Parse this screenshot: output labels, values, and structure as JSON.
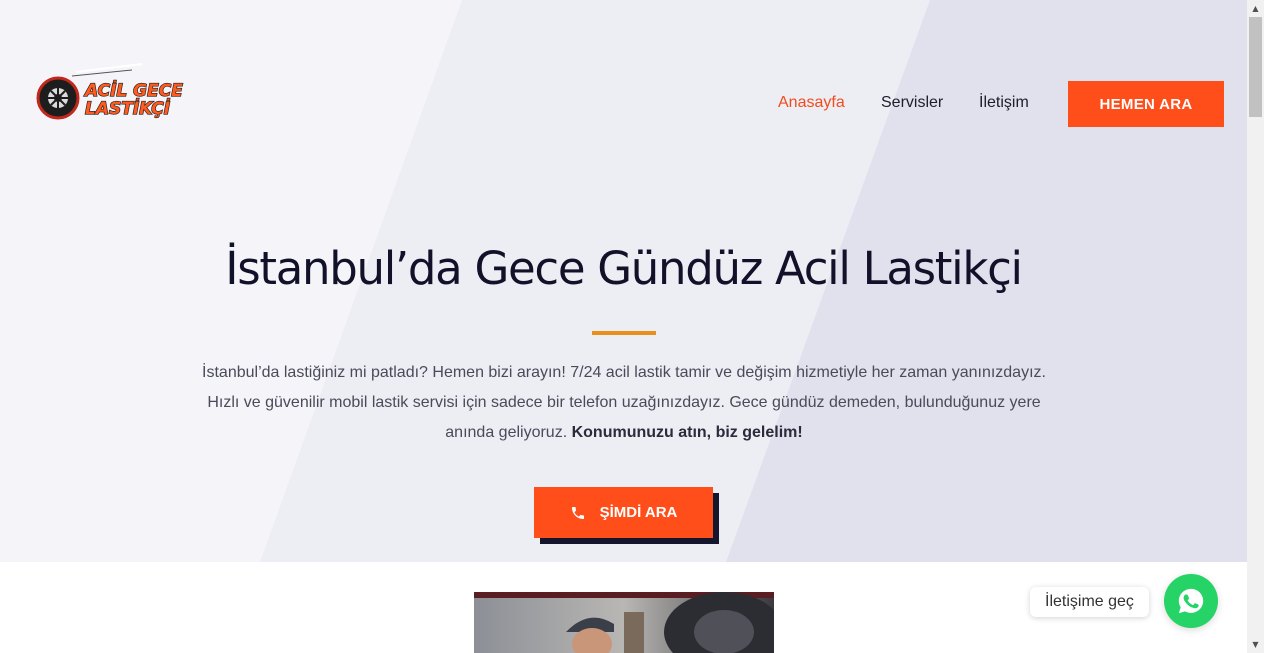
{
  "header": {
    "logo_text_line1": "ACİL GECE",
    "logo_text_line2": "LASTİKÇİ",
    "nav": [
      {
        "label": "Anasayfa",
        "active": true
      },
      {
        "label": "Servisler",
        "active": false
      },
      {
        "label": "İletişim",
        "active": false
      }
    ],
    "cta_label": "HEMEN ARA"
  },
  "hero": {
    "title": "İstanbul’da Gece Gündüz Acil Lastikçi",
    "text": "İstanbul’da lastiğiniz mi patladı? Hemen bizi arayın! 7/24 acil lastik tamir ve değişim hizmetiyle her zaman yanınızdayız. Hızlı ve güvenilir mobil lastik servisi için sadece bir telefon uzağınızdayız. Gece gündüz demeden, bulunduğunuz yere anında geliyoruz.",
    "text_bold": "Konumunuzu atın, biz gelelim!",
    "cta_label": "ŞİMDİ ARA",
    "cta_icon": "phone-icon"
  },
  "whatsapp": {
    "label": "İletişime geç",
    "icon": "whatsapp-icon"
  },
  "colors": {
    "accent": "#ff4e1a",
    "nav_active": "#f04d1f",
    "divider": "#e8901b",
    "dark": "#15162e",
    "whatsapp": "#25d366"
  }
}
